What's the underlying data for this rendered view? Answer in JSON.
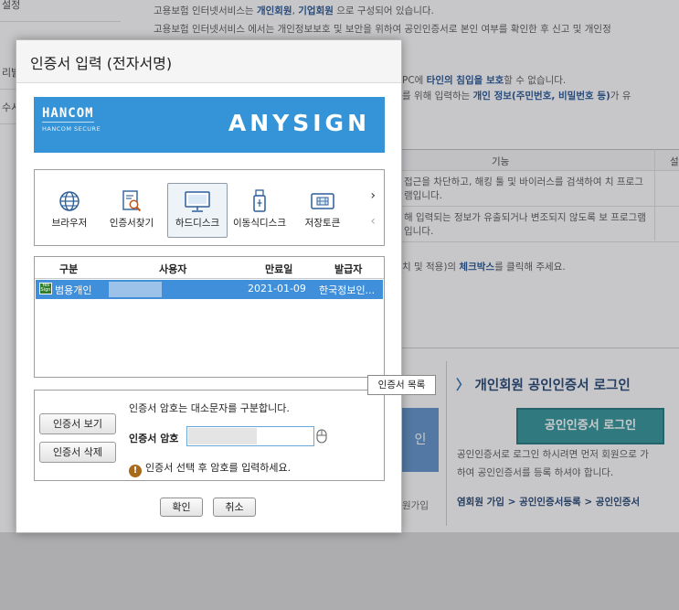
{
  "background": {
    "sidebar_items": [
      "설정",
      "리발",
      "수시"
    ],
    "intro_lines": [
      {
        "pre": "고용보험 인터넷서비스는 ",
        "b1": "개인회원",
        "mid": ", ",
        "b2": "기업회원",
        "post": " 으로 구성되어 있습니다."
      },
      {
        "pre": "고용보험 인터넷서비스 에서는 개인정보보호 및 보안을 위하여 공인인증서로 본인 여부를 확인한 후 신고 및 개인정",
        "b1": "",
        "mid": "",
        "b2": "",
        "post": ""
      }
    ],
    "security_lines": [
      {
        "pre": "PC에 ",
        "b1": "타인의 침입을 보호",
        "mid": "할 수 없습니다.",
        "b2": "",
        "post": ""
      },
      {
        "pre": "를 위해 입력하는 ",
        "b1": "개인 정보(주민번호, 비밀번호 등)",
        "mid": "가 유",
        "b2": "",
        "post": ""
      }
    ],
    "table": {
      "headers": [
        "기능",
        "설"
      ],
      "rows": [
        "접근을 차단하고, 해킹 툴 및 바이러스를 검색하여 치 프로그램입니다.",
        "해 입력되는 정보가 유출되거나 변조되지 않도록 보 프로그램입니다."
      ]
    },
    "checkbox_note": {
      "pre": "치 및 적용)의 ",
      "b1": "체크박스",
      "post": "를 클릭해 주세요."
    },
    "login_title": "개인회원 공인인증서 로그인",
    "login_arrow": "〉",
    "login_button": "공인인증서 로그인",
    "login_desc": [
      "공인인증서로 로그인 하시려면 먼저 회원으로 가",
      "하여 공인인증서를 등록 하셔야 합니다."
    ],
    "login_links": "염회원 가입 > 공인인증서등록 > 공인인증서",
    "left_button": "인",
    "left_join": "원가입"
  },
  "dialog": {
    "title": "인증서 입력 (전자서명)",
    "banner": {
      "logo_main": "HANCOM",
      "logo_sub": "HANCOM SECURE",
      "brand": "ANYSIGN"
    },
    "media": [
      {
        "label": "브라우저",
        "icon": "globe-icon",
        "selected": false
      },
      {
        "label": "인증서찾기",
        "icon": "certificate-search-icon",
        "selected": false
      },
      {
        "label": "하드디스크",
        "icon": "monitor-icon",
        "selected": true
      },
      {
        "label": "이동식디스크",
        "icon": "usb-drive-icon",
        "selected": false
      },
      {
        "label": "저장토큰",
        "icon": "token-chip-icon",
        "selected": false
      }
    ],
    "next_arrow": "›",
    "prev_arrow": "‹",
    "cert_table": {
      "headers": [
        "구분",
        "사용자",
        "만료일",
        "발급자"
      ],
      "rows": [
        {
          "type": "범용개인",
          "badge": "Yes Sign",
          "user": "",
          "expires": "2021-01-09",
          "issuer": "한국정보인..."
        }
      ]
    },
    "tooltip": "인증서 목록",
    "view_button": "인증서 보기",
    "delete_button": "인증서 삭제",
    "case_note": "인증서 암호는 대소문자를 구분합니다.",
    "password_label": "인증서 암호",
    "password_value": "",
    "warning": "인증서 선택 후 암호를 입력하세요.",
    "warning_icon": "!",
    "ok_button": "확인",
    "cancel_button": "취소"
  },
  "colors": {
    "banner": "#3594d7",
    "selection": "#3f8fda",
    "login_button": "#2a9196"
  }
}
